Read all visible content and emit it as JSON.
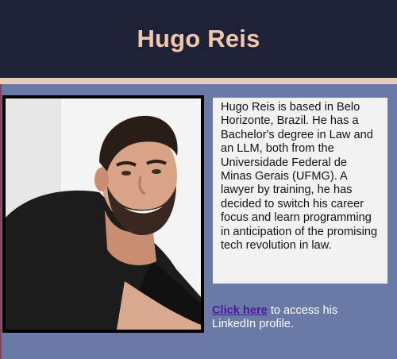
{
  "header": {
    "title": "Hugo Reis"
  },
  "profile": {
    "photo_icon": "profile-photo",
    "bio": "Hugo Reis is based in Belo Horizonte, Brazil. He has a Bachelor's degree in Law and an LLM, both from the Universidade Federal de Minas Gerais (UFMG). A lawyer by training, he has decided to switch his career focus and learn programming in anticipation of the promising tech revolution in law."
  },
  "link": {
    "label": "Click here",
    "suffix": " to access his LinkedIn profile."
  },
  "colors": {
    "header_bg": "#1f2236",
    "title": "#f0c9ad",
    "accent_bar": "#e9cdb9",
    "page_bg": "#6a79a6",
    "bio_bg": "#f2f2f2",
    "link": "#4a1aa0"
  }
}
